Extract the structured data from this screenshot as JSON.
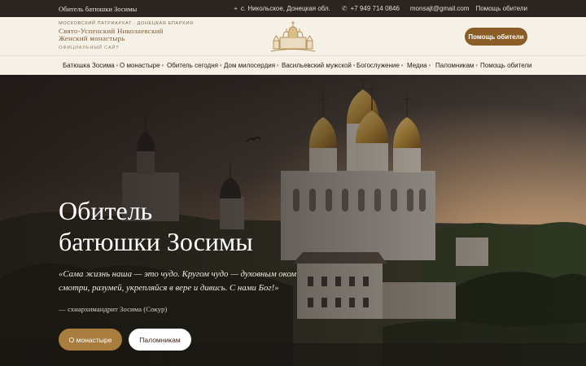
{
  "topbar": {
    "tagline": "Обитель батюшки Зосимы",
    "address": "с. Никольское, Донецкая обл.",
    "phone": "+7 949 714 0846",
    "email": "monsajt@gmail.com",
    "help_link": "Помощь обители",
    "icons": {
      "address": "map-pin-icon",
      "phone": "phone-icon"
    }
  },
  "header": {
    "brand_top": "МОСКОВСКИЙ ПАТРИАРХАТ · ДОНЕЦКАЯ ЕПАРХИЯ",
    "brand_name_line1": "Свято-Успенский Николаевский",
    "brand_name_line2": "Женский монастырь",
    "brand_sub": "ОФИЦИАЛЬНЫЙ САЙТ",
    "help_button": "Помощь обители"
  },
  "nav": {
    "items": [
      {
        "label": "Батюшка Зосима",
        "has_dropdown": true
      },
      {
        "label": "О монастыре",
        "has_dropdown": true
      },
      {
        "label": "Обитель сегодня",
        "has_dropdown": true
      },
      {
        "label": "Дом милосердия",
        "has_dropdown": true
      },
      {
        "label": "Васильевский мужской",
        "has_dropdown": true
      },
      {
        "label": "Богослужение",
        "has_dropdown": true
      },
      {
        "label": "Медиа",
        "has_dropdown": true
      },
      {
        "label": "Паломникам",
        "has_dropdown": true
      },
      {
        "label": "Помощь обители",
        "has_dropdown": false
      }
    ]
  },
  "hero": {
    "title_line1": "Обитель",
    "title_line2": "батюшки Зосимы",
    "quote": "«Сама жизнь наша — это чудо. Кругом чудо — духовным оком смотри, разумей, укрепляйся в вере и дивись. С нами Бог!»",
    "author": "— схиархимандрит Зосима (Сокур)",
    "btn_primary": "О монастыре",
    "btn_secondary": "Паломникам"
  },
  "colors": {
    "topbar_bg": "#2a2520",
    "header_bg": "#f6f1e6",
    "accent_brown": "#8a5c26",
    "accent_gold": "#a87d3e"
  }
}
